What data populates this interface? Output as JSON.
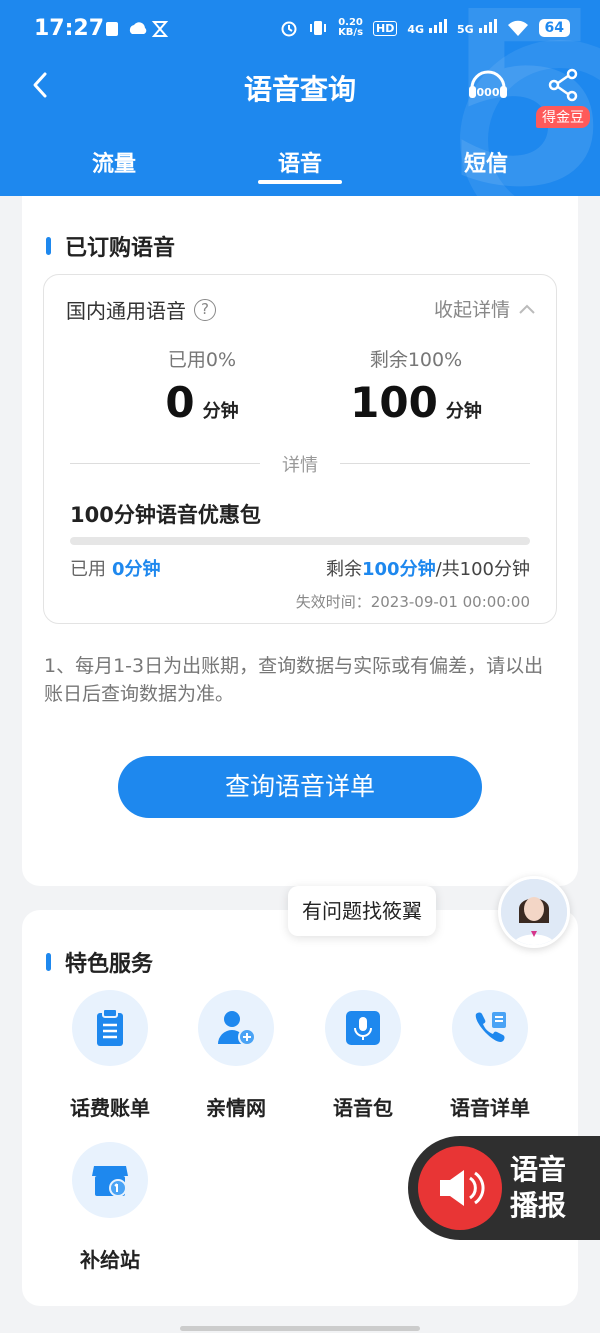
{
  "status_bar": {
    "time": "17:27",
    "net_speed_value": "0.20",
    "net_speed_unit": "KB/s",
    "hd": "HD",
    "sim1_net": "4G",
    "sim2_net": "5G",
    "battery": "64"
  },
  "header": {
    "title": "语音查询",
    "service_badge": "10000",
    "reward_badge": "得金豆"
  },
  "tabs": [
    {
      "label": "流量",
      "active": false
    },
    {
      "label": "语音",
      "active": true
    },
    {
      "label": "短信",
      "active": false
    }
  ],
  "subscribed": {
    "section_title": "已订购语音",
    "plan_name": "国内通用语音",
    "help_symbol": "?",
    "collapse_label": "收起详情",
    "used_label": "已用0%",
    "used_value": "0",
    "remain_label": "剩余100%",
    "remain_value": "100",
    "unit": "分钟",
    "detail_divider": "详情",
    "package": {
      "name": "100分钟语音优惠包",
      "used_fraction": 0,
      "used_prefix": "已用",
      "used_value": "0分钟",
      "remain_prefix": "剩余",
      "remain_value": "100分钟",
      "total_text": "/共100分钟",
      "expire_text": "失效时间：2023-09-01  00:00:00"
    },
    "notice": "1、每月1-3日为出账期，查询数据与实际或有偏差，请以出账日后查询数据为准。",
    "query_button": "查询语音详单"
  },
  "assistant": {
    "bubble": "有问题找筱翼"
  },
  "services": {
    "section_title": "特色服务",
    "items": [
      {
        "label": "话费账单",
        "icon": "bill-icon"
      },
      {
        "label": "亲情网",
        "icon": "family-add-icon"
      },
      {
        "label": "语音包",
        "icon": "microphone-icon"
      },
      {
        "label": "语音详单",
        "icon": "phone-list-icon"
      },
      {
        "label": "补给站",
        "icon": "shop-icon"
      }
    ]
  },
  "voice_broadcast": {
    "line1": "语音",
    "line2": "播报"
  },
  "colors": {
    "primary": "#1e88ee",
    "badge": "#ff5a5a",
    "voice_bg": "#2f2f2f",
    "voice_red": "#e83535"
  }
}
